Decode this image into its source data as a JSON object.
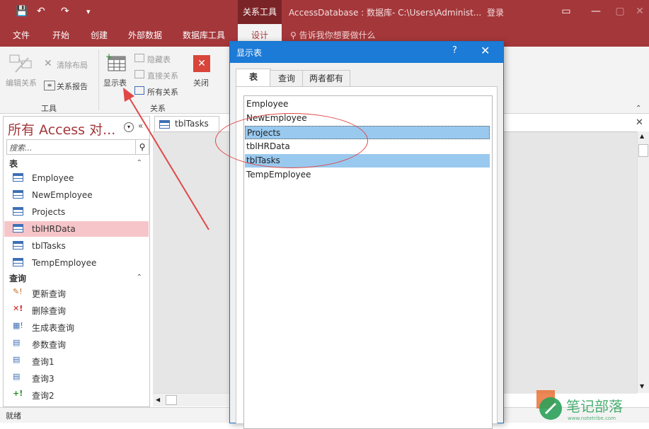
{
  "titlebar": {
    "context_tab": "关系工具",
    "title": "AccessDatabase : 数据库- C:\\Users\\Administ...",
    "login": "登录",
    "qat_save": "💾",
    "qat_undo": "↶",
    "qat_redo": "↷",
    "qat_more": "▾"
  },
  "ribbon_tabs": [
    "文件",
    "开始",
    "创建",
    "外部数据",
    "数据库工具",
    "设计"
  ],
  "tell_me": "告诉我你想要做什么",
  "ribbon": {
    "edit_relationships": "编辑关系",
    "clear_layout": "清除布局",
    "relationship_report": "关系报告",
    "tools_group": "工具",
    "show_table": "显示表",
    "hide_table": "隐藏表",
    "direct_relationships": "直接关系",
    "all_relationships": "所有关系",
    "close": "关闭",
    "relationships_group": "关系"
  },
  "nav": {
    "title": "所有 Access 对...",
    "search_placeholder": "搜索...",
    "tables_header": "表",
    "tables": [
      "Employee",
      "NewEmployee",
      "Projects",
      "tblHRData",
      "tblTasks",
      "TempEmployee"
    ],
    "selected_table": "tblHRData",
    "queries_header": "查询",
    "queries": [
      {
        "label": "更新查询",
        "icon": "update-query-icon"
      },
      {
        "label": "删除查询",
        "icon": "delete-query-icon"
      },
      {
        "label": "生成表查询",
        "icon": "make-table-query-icon"
      },
      {
        "label": "参数查询",
        "icon": "select-query-icon"
      },
      {
        "label": "查询1",
        "icon": "select-query-icon"
      },
      {
        "label": "查询3",
        "icon": "select-query-icon"
      },
      {
        "label": "查询2",
        "icon": "append-query-icon"
      }
    ]
  },
  "document": {
    "tab_label": "tblTasks"
  },
  "status": {
    "text": "就绪"
  },
  "dialog": {
    "title": "显示表",
    "help": "?",
    "close": "✕",
    "tabs": [
      "表",
      "查询",
      "两者都有"
    ],
    "items": [
      "Employee",
      "NewEmployee",
      "Projects",
      "tblHRData",
      "tblTasks",
      "TempEmployee"
    ],
    "selected_items": [
      "Projects",
      "tblTasks"
    ]
  },
  "colors": {
    "brand": "#a4373a",
    "dialog_title": "#1c7bd6",
    "selection": "#99c9ef",
    "nav_selection": "#f6c5c9",
    "annotation": "#e04848"
  }
}
